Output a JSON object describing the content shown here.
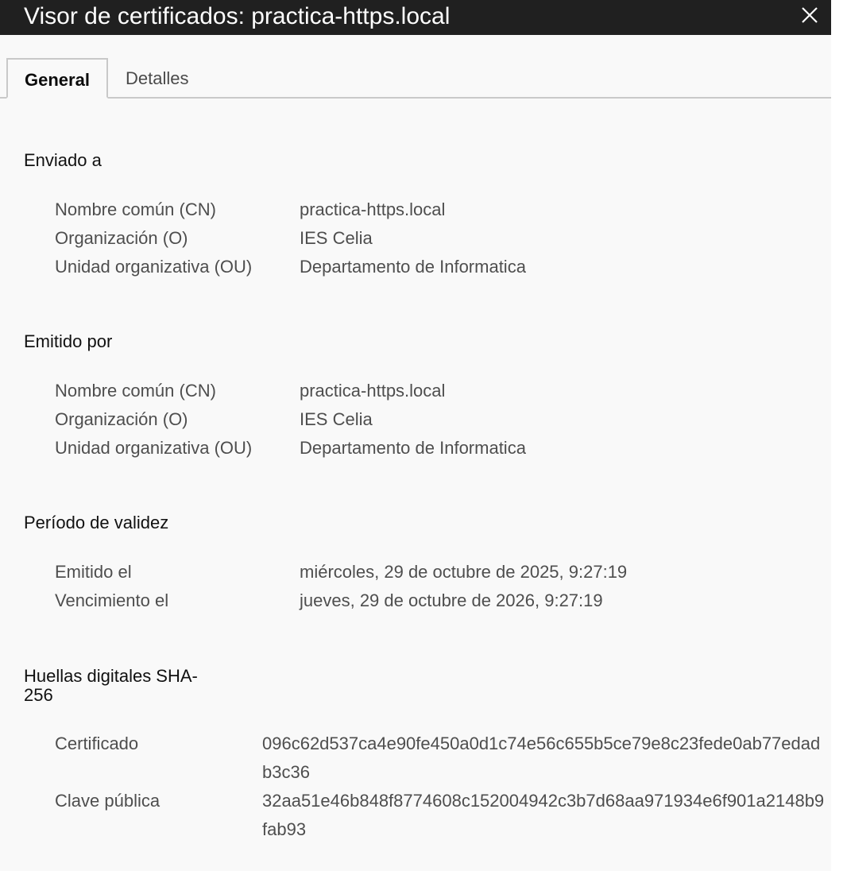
{
  "window": {
    "title": "Visor de certificados: practica-https.local"
  },
  "tabs": {
    "general": "General",
    "details": "Detalles"
  },
  "issued_to": {
    "heading": "Enviado a",
    "cn_label": "Nombre común (CN)",
    "cn_value": "practica-https.local",
    "o_label": "Organización (O)",
    "o_value": "IES Celia",
    "ou_label": "Unidad organizativa (OU)",
    "ou_value": "Departamento de Informatica"
  },
  "issued_by": {
    "heading": "Emitido por",
    "cn_label": "Nombre común (CN)",
    "cn_value": "practica-https.local",
    "o_label": "Organización (O)",
    "o_value": "IES Celia",
    "ou_label": "Unidad organizativa (OU)",
    "ou_value": "Departamento de Informatica"
  },
  "validity": {
    "heading": "Período de validez",
    "issued_label": "Emitido el",
    "issued_value": "miércoles, 29 de octubre de 2025, 9:27:19",
    "expires_label": "Vencimiento el",
    "expires_value": "jueves, 29 de octubre de 2026, 9:27:19"
  },
  "fingerprints": {
    "heading_line1": "Huellas digitales SHA-",
    "heading_line2": "256",
    "certificate_label": "Certificado",
    "certificate_value": "096c62d537ca4e90fe450a0d1c74e56c655b5ce79e8c23fede0ab77edadb3c36",
    "public_key_label": "Clave pública",
    "public_key_value": "32aa51e46b848f8774608c152004942c3b7d68aa971934e6f901a2148b9fab93"
  },
  "icons": {
    "close": "close-icon"
  }
}
